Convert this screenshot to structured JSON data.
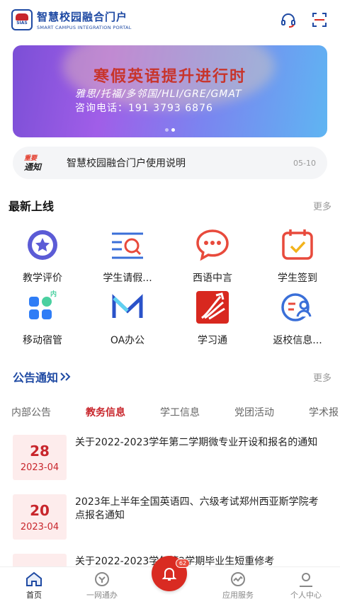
{
  "header": {
    "logo_abbr": "SIAS",
    "title": "智慧校园融合门户",
    "subtitle": "SMART CAMPUS INTEGRATION PORTAL",
    "icons": [
      "headset-icon",
      "scan-icon"
    ]
  },
  "banner": {
    "title": "寒假英语提升进行时",
    "subtitle": "雅思/托福/多邻国/HLI/GRE/GMAT",
    "phone": "咨询电话：191 3793 6876",
    "slides": 2,
    "active_slide": 2
  },
  "notice": {
    "tag_top": "重要",
    "tag_bottom": "通知",
    "text": "智慧校园融合门户使用说明",
    "date": "05-10"
  },
  "latest": {
    "title": "最新上线",
    "more": "更多",
    "apps": [
      {
        "label": "教学评价",
        "icon": "star-badge-icon",
        "color": "#5b5bd6"
      },
      {
        "label": "学生请假...",
        "icon": "search-list-icon",
        "color": "#3a6fd8"
      },
      {
        "label": "西语中言",
        "icon": "chat-bubble-icon",
        "color": "#e84a3c"
      },
      {
        "label": "学生签到",
        "icon": "calendar-check-icon",
        "color": "#e84a3c"
      },
      {
        "label": "移动宿管",
        "icon": "dorm-grid-icon",
        "color": "#2f7df6"
      },
      {
        "label": "OA办公",
        "icon": "oa-m-icon",
        "color": "#2a52c9"
      },
      {
        "label": "学习通",
        "icon": "xuexitong-icon",
        "color": "#d8281f"
      },
      {
        "label": "返校信息...",
        "icon": "user-return-icon",
        "color": "#3a6fd8"
      }
    ]
  },
  "announcements": {
    "title": "公告通知",
    "more": "更多",
    "tabs": [
      "内部公告",
      "教务信息",
      "学工信息",
      "党团活动",
      "学术报"
    ],
    "active_tab": 1,
    "items": [
      {
        "day": "28",
        "ym": "2023-04",
        "text": "关于2022-2023学年第二学期微专业开设和报名的通知"
      },
      {
        "day": "20",
        "ym": "2023-04",
        "text": "2023年上半年全国英语四、六级考试郑州西亚斯学院考点报名通知"
      },
      {
        "day": "",
        "ym": "",
        "text": "关于2022-2023学年第2学期毕业生短重修考"
      }
    ]
  },
  "bottom_nav": {
    "items": [
      {
        "label": "首页",
        "icon": "home-icon"
      },
      {
        "label": "一网通办",
        "icon": "one-stop-icon"
      },
      {
        "label": "",
        "icon": "bell-icon"
      },
      {
        "label": "应用服务",
        "icon": "pulse-icon"
      },
      {
        "label": "个人中心",
        "icon": "user-icon"
      }
    ],
    "badge": "62",
    "active": 0
  },
  "colors": {
    "brand_blue": "#1f4aa3",
    "accent_red": "#c8262c"
  }
}
